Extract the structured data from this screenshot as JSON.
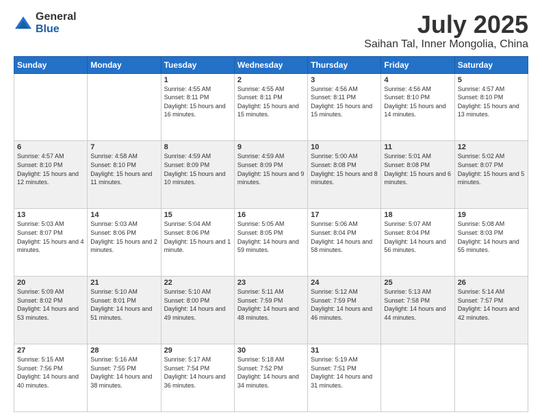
{
  "header": {
    "logo_general": "General",
    "logo_blue": "Blue",
    "title": "July 2025",
    "subtitle": "Saihan Tal, Inner Mongolia, China"
  },
  "weekdays": [
    "Sunday",
    "Monday",
    "Tuesday",
    "Wednesday",
    "Thursday",
    "Friday",
    "Saturday"
  ],
  "weeks": [
    [
      {
        "num": "",
        "info": ""
      },
      {
        "num": "",
        "info": ""
      },
      {
        "num": "1",
        "info": "Sunrise: 4:55 AM\nSunset: 8:11 PM\nDaylight: 15 hours and 16 minutes."
      },
      {
        "num": "2",
        "info": "Sunrise: 4:55 AM\nSunset: 8:11 PM\nDaylight: 15 hours and 15 minutes."
      },
      {
        "num": "3",
        "info": "Sunrise: 4:56 AM\nSunset: 8:11 PM\nDaylight: 15 hours and 15 minutes."
      },
      {
        "num": "4",
        "info": "Sunrise: 4:56 AM\nSunset: 8:10 PM\nDaylight: 15 hours and 14 minutes."
      },
      {
        "num": "5",
        "info": "Sunrise: 4:57 AM\nSunset: 8:10 PM\nDaylight: 15 hours and 13 minutes."
      }
    ],
    [
      {
        "num": "6",
        "info": "Sunrise: 4:57 AM\nSunset: 8:10 PM\nDaylight: 15 hours and 12 minutes."
      },
      {
        "num": "7",
        "info": "Sunrise: 4:58 AM\nSunset: 8:10 PM\nDaylight: 15 hours and 11 minutes."
      },
      {
        "num": "8",
        "info": "Sunrise: 4:59 AM\nSunset: 8:09 PM\nDaylight: 15 hours and 10 minutes."
      },
      {
        "num": "9",
        "info": "Sunrise: 4:59 AM\nSunset: 8:09 PM\nDaylight: 15 hours and 9 minutes."
      },
      {
        "num": "10",
        "info": "Sunrise: 5:00 AM\nSunset: 8:08 PM\nDaylight: 15 hours and 8 minutes."
      },
      {
        "num": "11",
        "info": "Sunrise: 5:01 AM\nSunset: 8:08 PM\nDaylight: 15 hours and 6 minutes."
      },
      {
        "num": "12",
        "info": "Sunrise: 5:02 AM\nSunset: 8:07 PM\nDaylight: 15 hours and 5 minutes."
      }
    ],
    [
      {
        "num": "13",
        "info": "Sunrise: 5:03 AM\nSunset: 8:07 PM\nDaylight: 15 hours and 4 minutes."
      },
      {
        "num": "14",
        "info": "Sunrise: 5:03 AM\nSunset: 8:06 PM\nDaylight: 15 hours and 2 minutes."
      },
      {
        "num": "15",
        "info": "Sunrise: 5:04 AM\nSunset: 8:06 PM\nDaylight: 15 hours and 1 minute."
      },
      {
        "num": "16",
        "info": "Sunrise: 5:05 AM\nSunset: 8:05 PM\nDaylight: 14 hours and 59 minutes."
      },
      {
        "num": "17",
        "info": "Sunrise: 5:06 AM\nSunset: 8:04 PM\nDaylight: 14 hours and 58 minutes."
      },
      {
        "num": "18",
        "info": "Sunrise: 5:07 AM\nSunset: 8:04 PM\nDaylight: 14 hours and 56 minutes."
      },
      {
        "num": "19",
        "info": "Sunrise: 5:08 AM\nSunset: 8:03 PM\nDaylight: 14 hours and 55 minutes."
      }
    ],
    [
      {
        "num": "20",
        "info": "Sunrise: 5:09 AM\nSunset: 8:02 PM\nDaylight: 14 hours and 53 minutes."
      },
      {
        "num": "21",
        "info": "Sunrise: 5:10 AM\nSunset: 8:01 PM\nDaylight: 14 hours and 51 minutes."
      },
      {
        "num": "22",
        "info": "Sunrise: 5:10 AM\nSunset: 8:00 PM\nDaylight: 14 hours and 49 minutes."
      },
      {
        "num": "23",
        "info": "Sunrise: 5:11 AM\nSunset: 7:59 PM\nDaylight: 14 hours and 48 minutes."
      },
      {
        "num": "24",
        "info": "Sunrise: 5:12 AM\nSunset: 7:59 PM\nDaylight: 14 hours and 46 minutes."
      },
      {
        "num": "25",
        "info": "Sunrise: 5:13 AM\nSunset: 7:58 PM\nDaylight: 14 hours and 44 minutes."
      },
      {
        "num": "26",
        "info": "Sunrise: 5:14 AM\nSunset: 7:57 PM\nDaylight: 14 hours and 42 minutes."
      }
    ],
    [
      {
        "num": "27",
        "info": "Sunrise: 5:15 AM\nSunset: 7:56 PM\nDaylight: 14 hours and 40 minutes."
      },
      {
        "num": "28",
        "info": "Sunrise: 5:16 AM\nSunset: 7:55 PM\nDaylight: 14 hours and 38 minutes."
      },
      {
        "num": "29",
        "info": "Sunrise: 5:17 AM\nSunset: 7:54 PM\nDaylight: 14 hours and 36 minutes."
      },
      {
        "num": "30",
        "info": "Sunrise: 5:18 AM\nSunset: 7:52 PM\nDaylight: 14 hours and 34 minutes."
      },
      {
        "num": "31",
        "info": "Sunrise: 5:19 AM\nSunset: 7:51 PM\nDaylight: 14 hours and 31 minutes."
      },
      {
        "num": "",
        "info": ""
      },
      {
        "num": "",
        "info": ""
      }
    ]
  ]
}
